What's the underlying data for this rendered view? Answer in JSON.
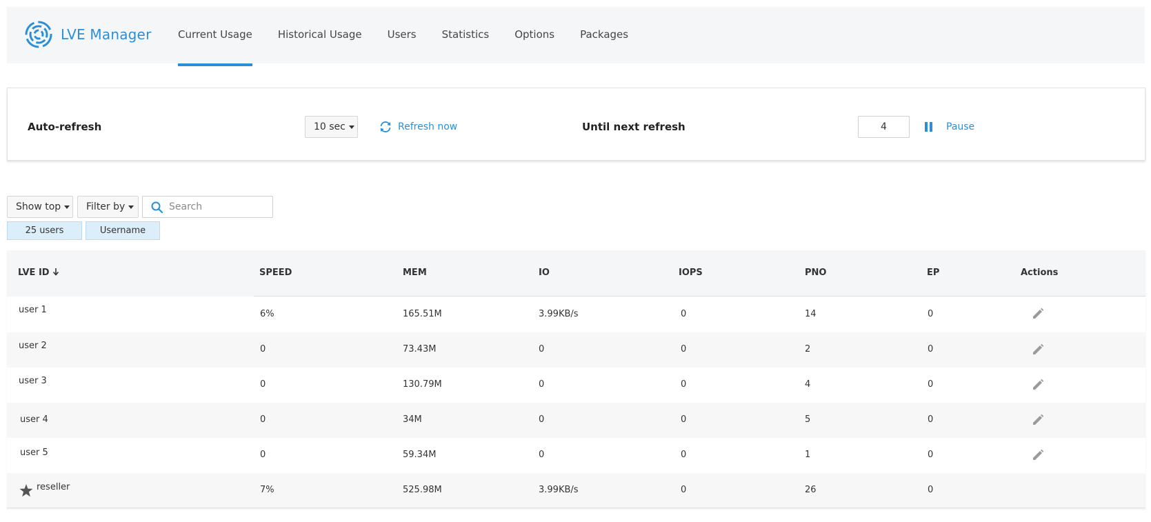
{
  "app": {
    "name": "LVE Manager",
    "brand_color": "#2a8fd8"
  },
  "nav": {
    "tabs": [
      {
        "label": "Current Usage",
        "active": true
      },
      {
        "label": "Historical Usage",
        "active": false
      },
      {
        "label": "Users",
        "active": false
      },
      {
        "label": "Statistics",
        "active": false
      },
      {
        "label": "Options",
        "active": false
      },
      {
        "label": "Packages",
        "active": false
      }
    ]
  },
  "refresh": {
    "auto_refresh_label": "Auto-refresh",
    "interval_value": "10 sec",
    "refresh_now_label": "Refresh now",
    "until_next_label": "Until next refresh",
    "counter_value": "4",
    "pause_label": "Pause"
  },
  "filters": {
    "show_top_label": "Show top",
    "filter_by_label": "Filter by",
    "search_placeholder": "Search",
    "chips": [
      "25 users",
      "Username"
    ]
  },
  "table": {
    "columns": [
      "LVE ID",
      "SPEED",
      "MEM",
      "IO",
      "IOPS",
      "PNO",
      "EP",
      "Actions"
    ],
    "sort_column": "LVE ID",
    "sort_direction": "descending",
    "rows": [
      {
        "id": "user 1",
        "speed": "6%",
        "mem": "165.51M",
        "io": "3.99KB/s",
        "iops": "0",
        "pno": "14",
        "ep": "0",
        "editable": true
      },
      {
        "id": "user 2",
        "speed": "0",
        "mem": "73.43M",
        "io": "0",
        "iops": "0",
        "pno": "2",
        "ep": "0",
        "editable": true
      },
      {
        "id": "user 3",
        "speed": "0",
        "mem": "130.79M",
        "io": "0",
        "iops": "0",
        "pno": "4",
        "ep": "0",
        "editable": true
      },
      {
        "id": "user 4",
        "speed": "0",
        "mem": "34M",
        "io": "0",
        "iops": "0",
        "pno": "5",
        "ep": "0",
        "editable": true
      },
      {
        "id": "user 5",
        "speed": "0",
        "mem": "59.34M",
        "io": "0",
        "iops": "0",
        "pno": "1",
        "ep": "0",
        "editable": true
      },
      {
        "id": "reseller",
        "speed": "7%",
        "mem": "525.98M",
        "io": "3.99KB/s",
        "iops": "0",
        "pno": "26",
        "ep": "0",
        "editable": false,
        "icon": "star-icon"
      }
    ]
  }
}
